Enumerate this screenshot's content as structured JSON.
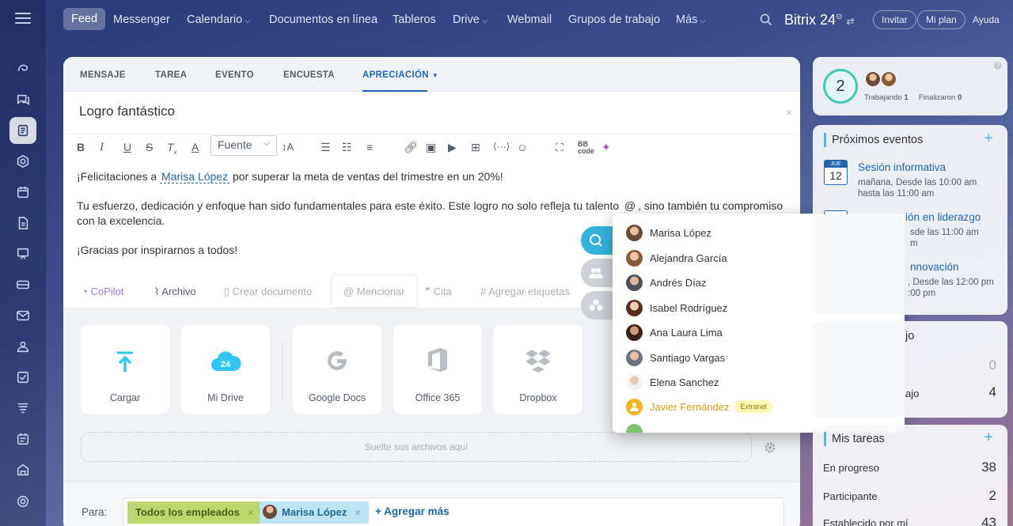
{
  "topnav": {
    "items": [
      {
        "label": "Feed",
        "dropdown": false
      },
      {
        "label": "Messenger",
        "dropdown": false
      },
      {
        "label": "Calendario",
        "dropdown": true
      },
      {
        "label": "Documentos en línea",
        "dropdown": false
      },
      {
        "label": "Tableros",
        "dropdown": false
      },
      {
        "label": "Drive",
        "dropdown": true
      },
      {
        "label": "Webmail",
        "dropdown": false
      },
      {
        "label": "Grupos de trabajo",
        "dropdown": false
      },
      {
        "label": "Más",
        "dropdown": true
      }
    ],
    "brand": "Bitrix 24",
    "invite": "Invitar",
    "plan": "Mi plan",
    "help": "Ayuda"
  },
  "composer": {
    "tabs": [
      "MENSAJE",
      "TAREA",
      "EVENTO",
      "ENCUESTA",
      "APRECIACIÓN"
    ],
    "title": "Logro fantástico",
    "font_select": "Fuente",
    "body": {
      "line1_before": "¡Felicitaciones a ",
      "line1_mention": "Marisa López",
      "line1_after": " por superar la meta de ventas del trimestre en un 20%!",
      "line2_before": "Tu esfuerzo, dedicación y enfoque han sido fundamentales para este éxito. Este logro no solo refleja tu talento ",
      "line2_at": "@",
      "line2_after": ", sino también tu compromiso con la excelencia.",
      "line3": "¡Gracias por inspirarnos a todos!"
    },
    "actions": {
      "copilot": "CoPilot",
      "file": "Archivo",
      "create_doc": "Crear documento",
      "mention": "Mencionar",
      "quote": "Cita",
      "tags": "Agregar etiquetas"
    },
    "uploads": [
      "Cargar",
      "Mi Drive",
      "Google Docs",
      "Office 365",
      "Dropbox"
    ],
    "drop_text": "Suelte sus archivos aquí",
    "to": {
      "label": "Para:",
      "all": "Todos los empleados",
      "person": "Marisa López",
      "add_more": "+ Agregar más"
    }
  },
  "mention_dropdown": {
    "items": [
      {
        "name": "Marisa López"
      },
      {
        "name": "Alejandra García"
      },
      {
        "name": "Andrés Díaz"
      },
      {
        "name": "Isabel Rodríguez"
      },
      {
        "name": "Ana Laura Lima"
      },
      {
        "name": "Santiago Vargas"
      },
      {
        "name": "Elena Sanchez"
      },
      {
        "name": "Javier Fernández",
        "badge": "Extranet"
      }
    ]
  },
  "right": {
    "worktime": {
      "count": "2",
      "working_label": "Trabajando",
      "working": "1",
      "finished_label": "Finalizaron",
      "finished": "0"
    },
    "events": {
      "title": "Próximos eventos",
      "list": [
        {
          "month": "JUE",
          "day": "12",
          "title": "Sesión informativa",
          "line1": "mañana, Desde las 10:00 am",
          "line2": "hasta las 11:00 am"
        },
        {
          "title": "ión en liderazgo",
          "line1": "sde las 11:00 am",
          "line2": "m"
        },
        {
          "title": "nnovación",
          "line1": ", Desde las 12:00 pm",
          "line2": ":00 pm"
        }
      ]
    },
    "widget3": {
      "title": "jo",
      "v1": "0",
      "label2": "ajo",
      "v2": "4"
    },
    "tasks": {
      "title": "Mis tareas",
      "rows": [
        {
          "label": "En progreso",
          "value": "38"
        },
        {
          "label": "Participante",
          "value": "2"
        },
        {
          "label": "Establecido por mí",
          "value": "43"
        }
      ]
    }
  },
  "colors": {
    "accent": "#2067b0",
    "cyan": "#2fc6f6",
    "chip_all": "#bcd86d",
    "chip_person": "#bde4f3"
  }
}
